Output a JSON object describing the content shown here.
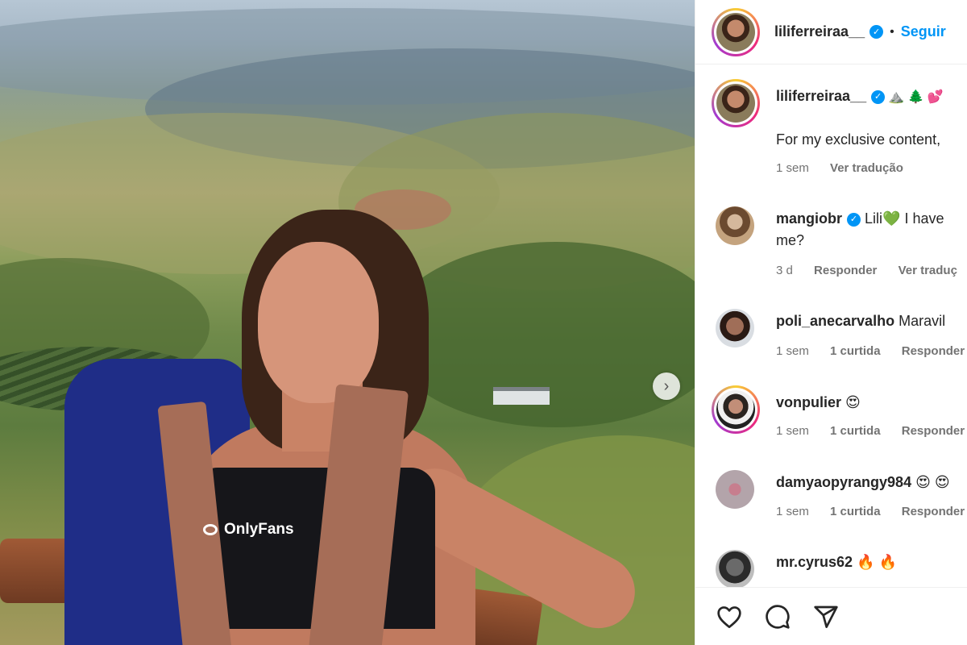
{
  "post": {
    "image_brand_text": "OnlyFans"
  },
  "header": {
    "username": "liliferreiraa__",
    "separator": "•",
    "follow_label": "Seguir"
  },
  "caption": {
    "username": "liliferreiraa__",
    "emojis": "⛰️ 🌲 💕",
    "text": "For my exclusive content,",
    "time": "1 sem",
    "translate_label": "Ver tradução"
  },
  "comments": [
    {
      "username": "mangiobr",
      "text_line1": "Lili💚 I have",
      "text_line2": "me?",
      "time": "3 d",
      "reply_label": "Responder",
      "translate_label": "Ver traduç"
    },
    {
      "username": "poli_anecarvalho",
      "text": "Maravil",
      "time": "1 sem",
      "likes": "1 curtida",
      "reply_label": "Responder"
    },
    {
      "username": "vonpulier",
      "text": "😍",
      "time": "1 sem",
      "likes": "1 curtida",
      "reply_label": "Responder"
    },
    {
      "username": "damyaopyrangy984",
      "text": "😍 😍",
      "time": "1 sem",
      "likes": "1 curtida",
      "reply_label": "Responder"
    },
    {
      "username": "mr.cyrus62",
      "text": "🔥 🔥"
    }
  ],
  "icons": {
    "next": "chevron-right-icon",
    "like": "heart-icon",
    "comment": "comment-icon",
    "share": "send-icon",
    "verified": "verified-badge-icon"
  },
  "colors": {
    "link_blue": "#0095f6",
    "meta_gray": "#737373",
    "text": "#262626"
  }
}
